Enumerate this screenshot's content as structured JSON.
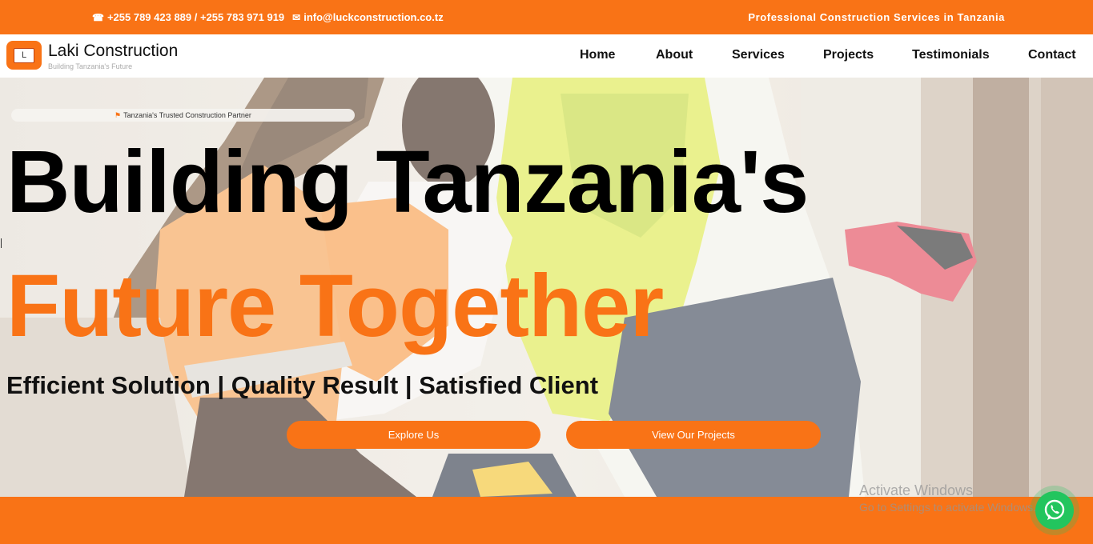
{
  "topbar": {
    "phone_icon": "phone-icon",
    "phones": "+255 789 423 889 / +255 783 971 919",
    "mail_icon": "mail-icon",
    "email": "info@luckconstruction.co.tz",
    "tagline": "Professional Construction Services in Tanzania"
  },
  "header": {
    "logo_letter": "L",
    "brand": "Laki Construction",
    "brand_sub": "Building Tanzania's Future",
    "nav": [
      "Home",
      "About",
      "Services",
      "Projects",
      "Testimonials",
      "Contact"
    ]
  },
  "hero": {
    "badge": "Tanzania's Trusted Construction Partner",
    "badge_icon": "flag-icon",
    "headline_line1": "Building Tanzania's",
    "headline_line2": "Future Together",
    "subheadline": "Efficient Solution | Quality Result | Satisfied Client",
    "buttons": [
      "Explore Us",
      "View Our Projects"
    ]
  },
  "overlay": {
    "activation_title": "Activate Windows",
    "activation_sub": "Go to Settings to activate Windows.",
    "whatsapp_icon": "whatsapp-icon"
  },
  "colors": {
    "accent": "#f97316",
    "text_dark": "#111111",
    "whatsapp": "#22c55e"
  }
}
